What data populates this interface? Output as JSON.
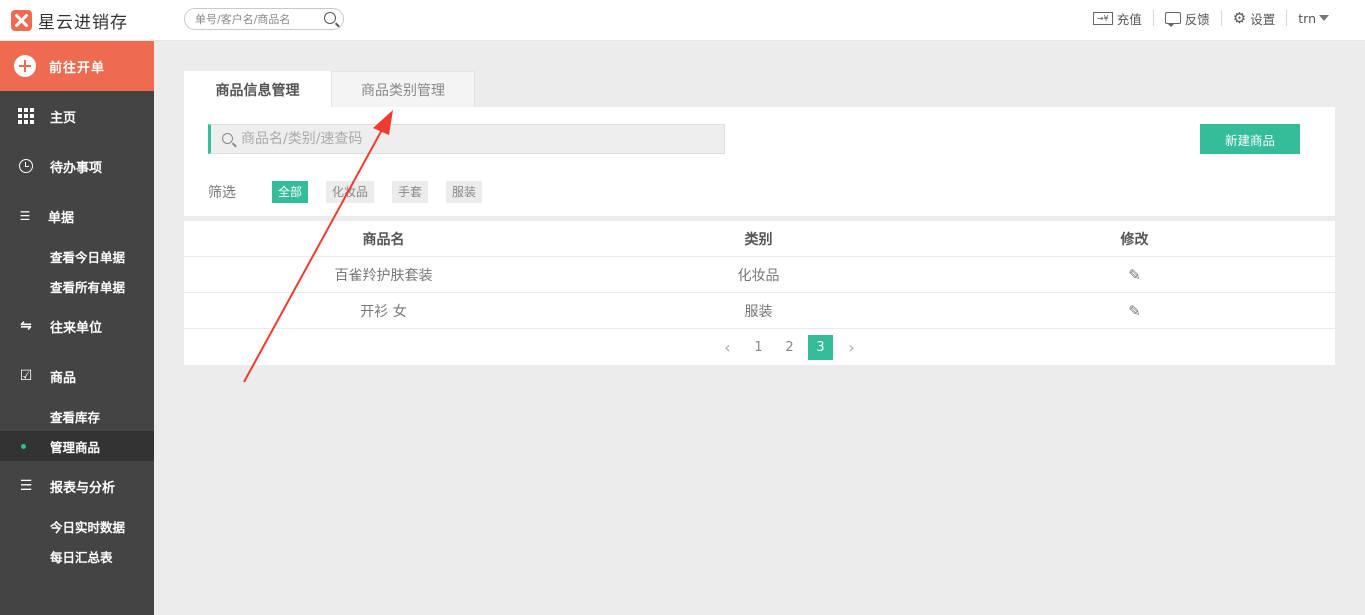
{
  "app": {
    "name": "星云进销存"
  },
  "header": {
    "search_placeholder": "单号/客户名/商品名",
    "recharge_icon_text": "→¥",
    "recharge_label": "充值",
    "feedback_label": "反馈",
    "settings_label": "设置",
    "user_label": "trn"
  },
  "sidebar": {
    "new_order": "前往开单",
    "groups": [
      {
        "label": "主页"
      },
      {
        "label": "待办事项"
      },
      {
        "label": "单据",
        "items": [
          "查看今日单据",
          "查看所有单据"
        ]
      },
      {
        "label": "往来单位"
      },
      {
        "label": "商品",
        "items": [
          "查看库存",
          "管理商品"
        ]
      },
      {
        "label": "报表与分析",
        "items": [
          "今日实时数据",
          "每日汇总表"
        ]
      }
    ],
    "active_item": "管理商品"
  },
  "tabs": [
    {
      "label": "商品信息管理",
      "active": true
    },
    {
      "label": "商品类别管理",
      "active": false
    }
  ],
  "search": {
    "placeholder": "商品名/类别/速查码"
  },
  "new_button": "新建商品",
  "filter": {
    "label": "筛选",
    "chips": [
      {
        "label": "全部",
        "active": true
      },
      {
        "label": "化妆品",
        "active": false
      },
      {
        "label": "手套",
        "active": false
      },
      {
        "label": "服装",
        "active": false
      }
    ]
  },
  "table": {
    "columns": [
      "商品名",
      "类别",
      "修改"
    ],
    "rows": [
      {
        "name": "百雀羚护肤套装",
        "category": "化妆品"
      },
      {
        "name": "开衫 女",
        "category": "服装"
      }
    ]
  },
  "pagination": {
    "pages": [
      "1",
      "2",
      "3"
    ],
    "current": "3"
  },
  "colors": {
    "accent": "#35bc98",
    "brand": "#ee6b52",
    "sidebar": "#444444",
    "annotation": "#f03a30"
  }
}
